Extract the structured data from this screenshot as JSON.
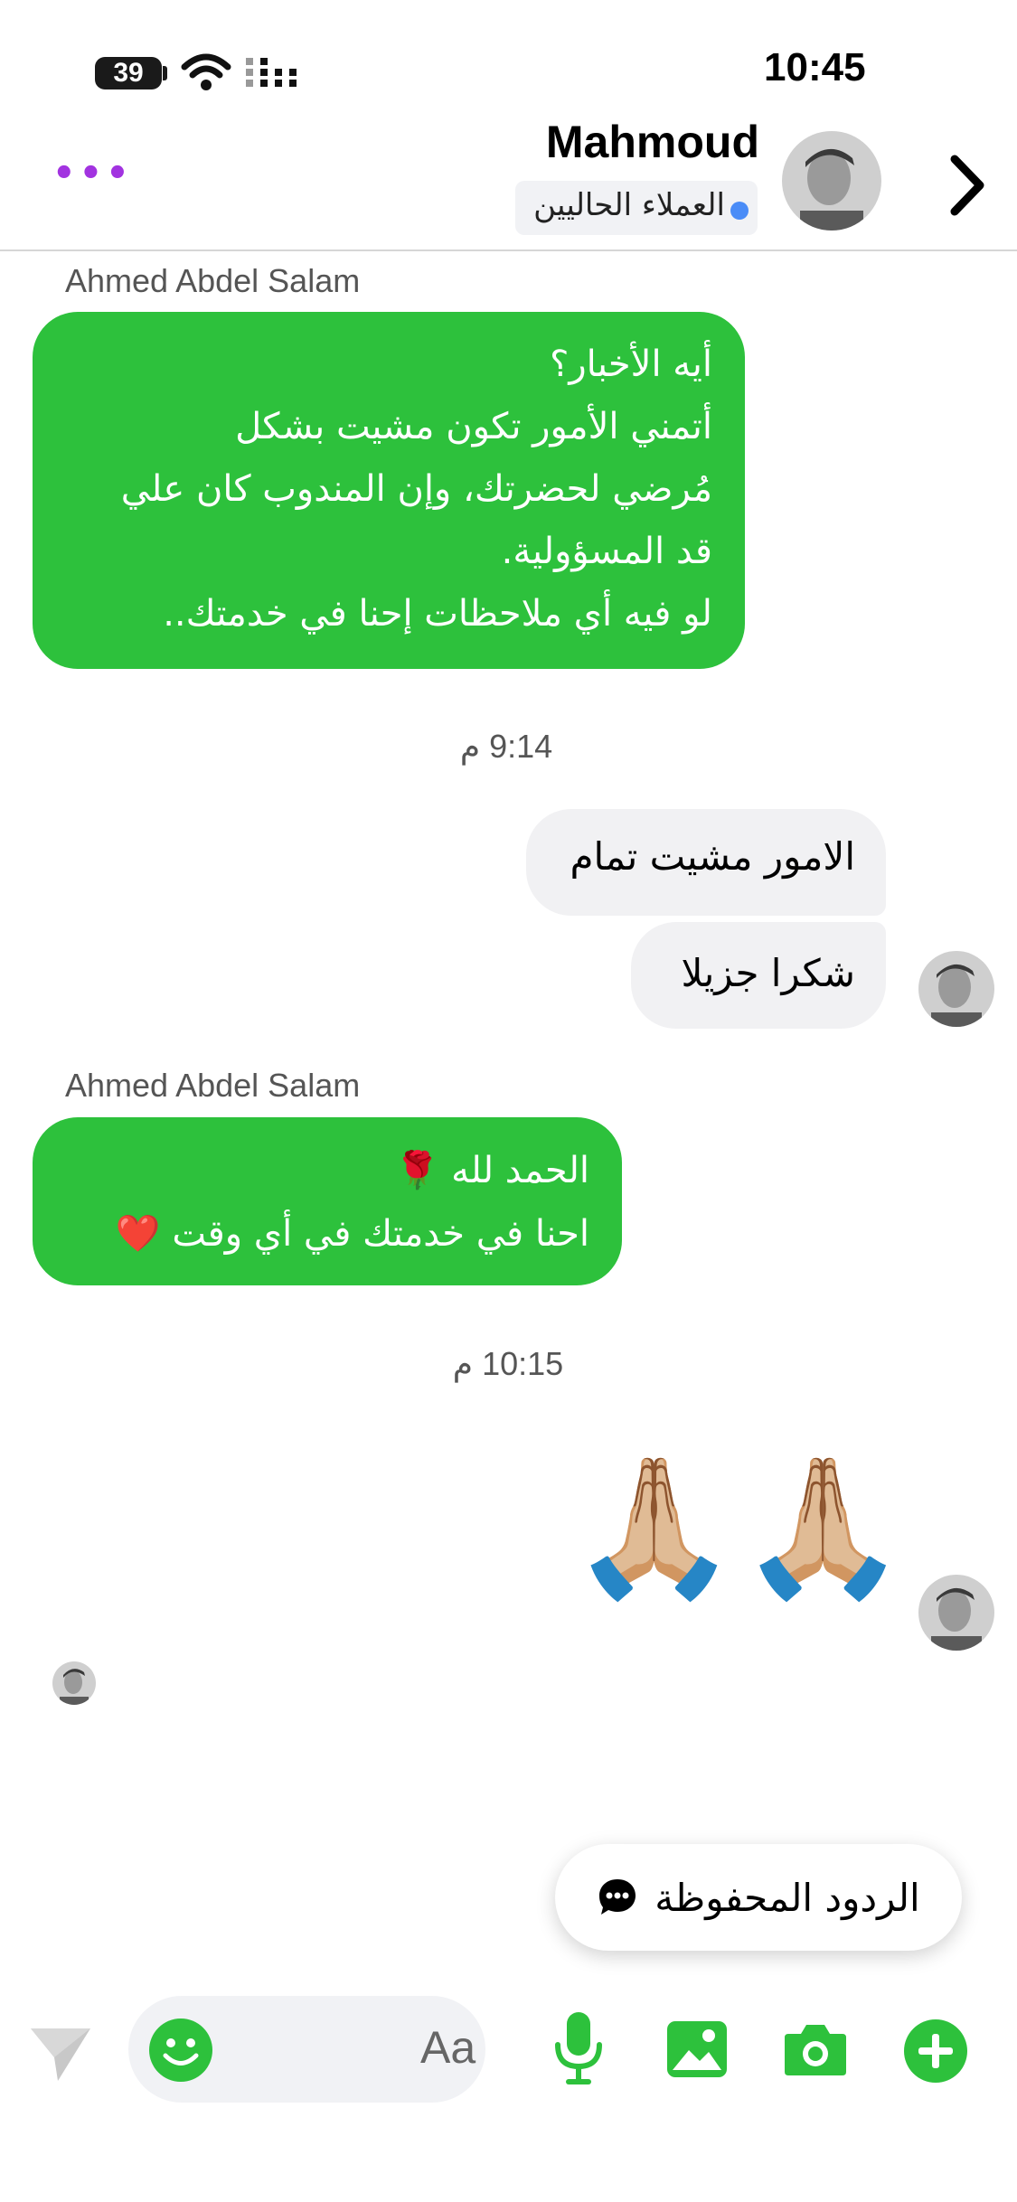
{
  "status_bar": {
    "time": "10:45",
    "battery": "39"
  },
  "header": {
    "name": "Mahmoud",
    "tag": "العملاء الحاليين"
  },
  "messages": [
    {
      "sender": "Ahmed Abdel Salam",
      "lines": [
        "أيه الأخبار؟",
        "أتمني الأمور تكون مشيت بشكل",
        "مُرضي لحضرتك، وإن المندوب كان علي",
        "قد المسؤولية.",
        "لو فيه أي ملاحظات إحنا في خدمتك.."
      ]
    },
    {
      "time": "9:14 م"
    },
    {
      "text_1": "الامور مشيت تمام",
      "text_2": "شكرا جزيلا"
    },
    {
      "sender": "Ahmed Abdel Salam",
      "lines": [
        "الحمد لله 🌹",
        "احنا في خدمتك في أي وقت ❤️"
      ]
    },
    {
      "time": "10:15 م"
    },
    {
      "emoji": "🙏🏼🙏🏼"
    }
  ],
  "saved_replies": {
    "label": "الردود المحفوظة"
  },
  "composer": {
    "placeholder": "Aa"
  },
  "icons": {
    "accent": "#2dc13c",
    "dots_color": "#a233e0",
    "names": [
      "battery-icon",
      "wifi-icon",
      "signal-icon",
      "more-icon",
      "back-icon",
      "send-icon",
      "emoji-icon",
      "microphone-icon",
      "gallery-icon",
      "camera-icon",
      "add-icon",
      "chat-bubble-icon"
    ]
  }
}
